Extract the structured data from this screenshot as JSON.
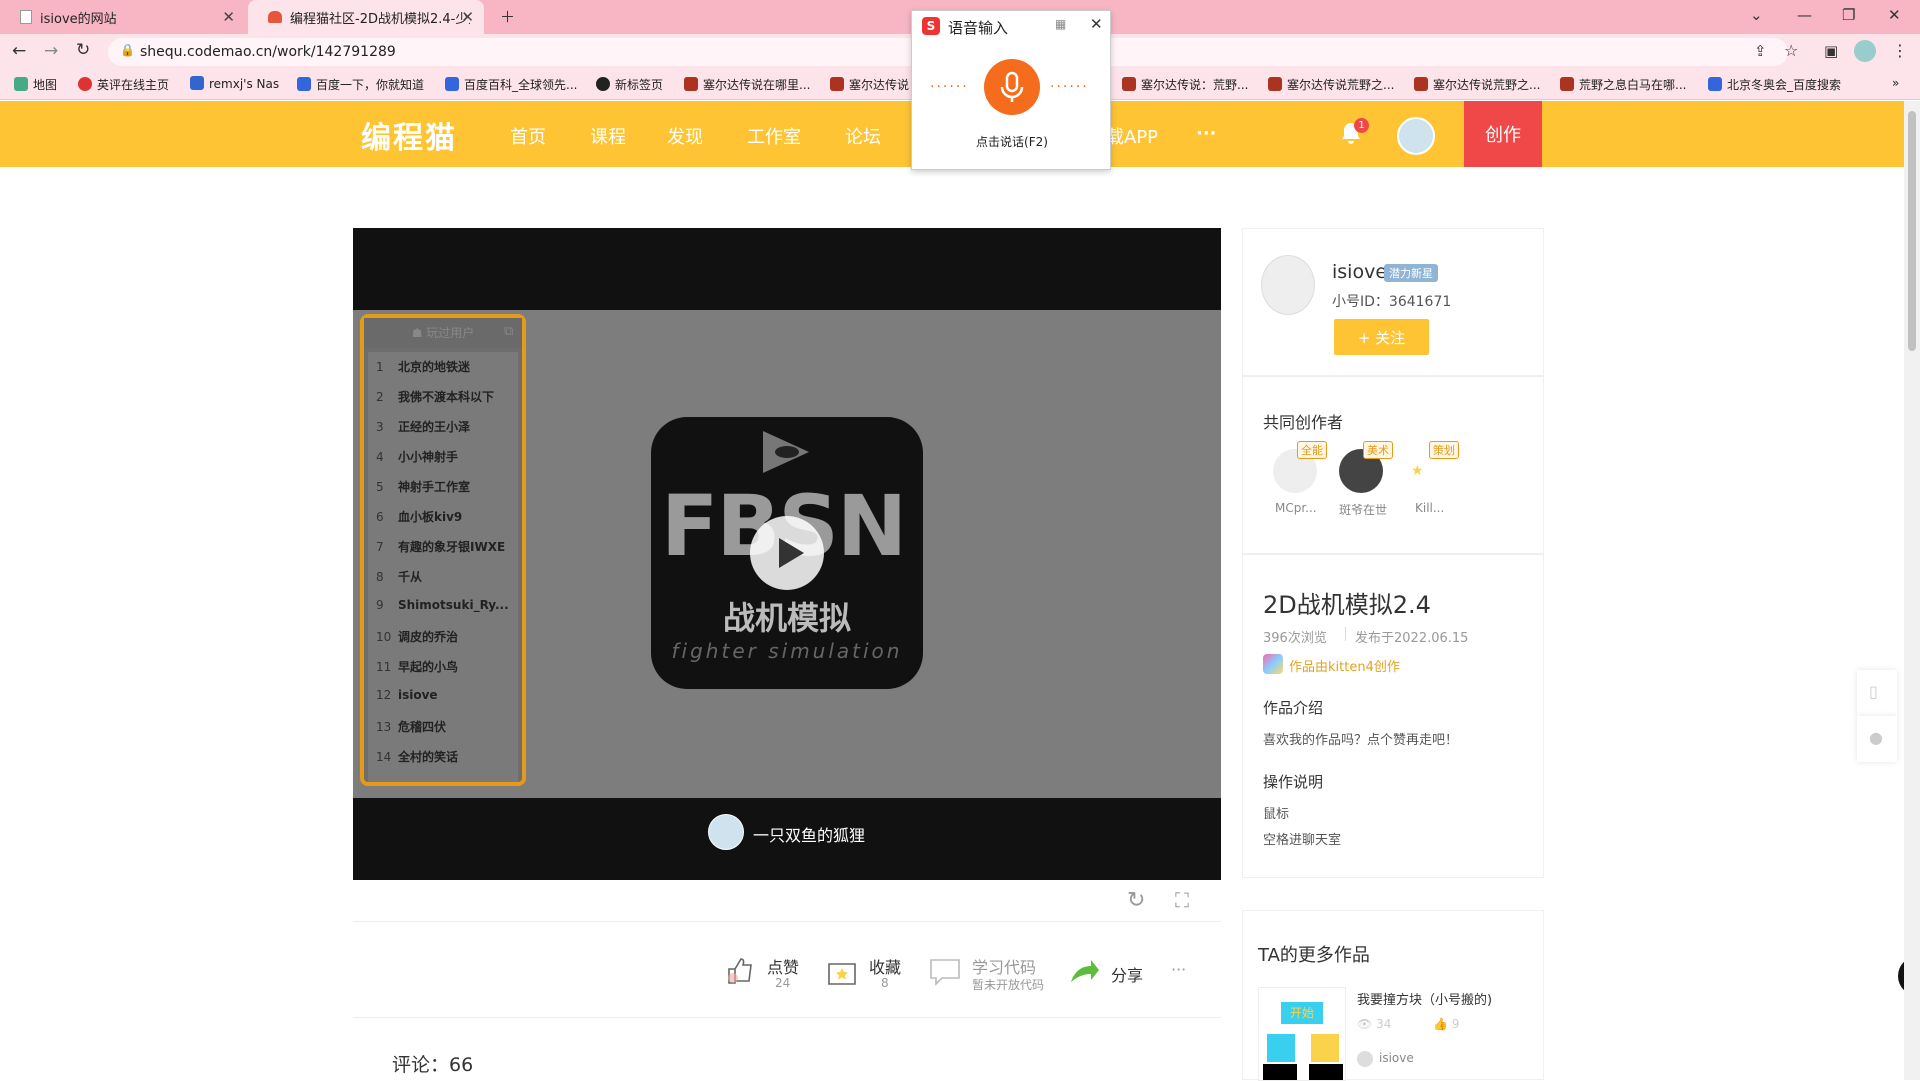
{
  "browser": {
    "tabs": [
      {
        "title": "isiove的网站"
      },
      {
        "title": "编程猫社区-2D战机模拟2.4-少儿"
      }
    ],
    "url": "shequ.codemao.cn/work/142791289",
    "bookmarks": [
      "地图",
      "英评在线主页",
      "remxj's Nas",
      "百度一下，你就知道",
      "百度百科_全球领先...",
      "新标签页",
      "塞尔达传说在哪里...",
      "塞尔达传说",
      "塞尔达传说：荒野...",
      "塞尔达传说荒野之...",
      "塞尔达传说荒野之...",
      "荒野之息白马在哪...",
      "北京冬奥会_百度搜索"
    ]
  },
  "voice_popup": {
    "title": "语音输入",
    "hint": "点击说话(F2)"
  },
  "site": {
    "logo": "编程猫",
    "nav": [
      "首页",
      "课程",
      "发现",
      "工作室",
      "论坛",
      "载APP",
      "···"
    ],
    "notification_count": "1",
    "create_label": "创作"
  },
  "player": {
    "leaderboard_title": "玩过用户",
    "leaderboard": [
      {
        "rank": "1",
        "name": "北京的地铁迷"
      },
      {
        "rank": "2",
        "name": "我佛不渡本科以下"
      },
      {
        "rank": "3",
        "name": "正经的王小泽"
      },
      {
        "rank": "4",
        "name": "小小神射手"
      },
      {
        "rank": "5",
        "name": "神射手工作室"
      },
      {
        "rank": "6",
        "name": "血小板kiv9"
      },
      {
        "rank": "7",
        "name": "有趣的象牙银IWXE"
      },
      {
        "rank": "8",
        "name": "千从"
      },
      {
        "rank": "9",
        "name": "Shimotsuki_Ry..."
      },
      {
        "rank": "10",
        "name": "调皮的乔治"
      },
      {
        "rank": "11",
        "name": "早起的小鸟"
      },
      {
        "rank": "12",
        "name": "isiove"
      },
      {
        "rank": "13",
        "name": "危稽四伏"
      },
      {
        "rank": "14",
        "name": "全村的笑话"
      }
    ],
    "game_title": "战机模拟",
    "game_subtitle": "fighter simulation",
    "game_logo_text": "FBSN",
    "author": "一只双鱼的狐狸"
  },
  "actions": {
    "like": {
      "label": "点赞",
      "count": "24"
    },
    "collect": {
      "label": "收藏",
      "count": "8"
    },
    "learn": {
      "label": "学习代码",
      "sub": "暂未开放代码"
    },
    "share": {
      "label": "分享"
    },
    "more": "···"
  },
  "comments": "评论：66",
  "user": {
    "name": "isiove",
    "badge": "潜力新星",
    "id_text": "小号ID：3641671",
    "follow_label": "+ 关注"
  },
  "coauthors": {
    "title": "共同创作者",
    "list": [
      {
        "name": "MCpr...",
        "role": "全能"
      },
      {
        "name": "斑爷在世",
        "role": "美术"
      },
      {
        "name": "Kill...",
        "role": "策划"
      }
    ]
  },
  "work": {
    "title": "2D战机模拟2.4",
    "views": "396次浏览",
    "published": "发布于2022.06.15",
    "tool": "作品由kitten4创作",
    "intro_heading": "作品介绍",
    "intro": "喜欢我的作品吗？点个赞再走吧！",
    "ops_heading": "操作说明",
    "ops": [
      "鼠标",
      "空格进聊天室"
    ]
  },
  "more_works": {
    "title": "TA的更多作品",
    "item": {
      "title": "我要撞方块（小号搬的)",
      "views": "34",
      "likes": "9",
      "author": "isiove",
      "thumb_text": "开始"
    }
  }
}
